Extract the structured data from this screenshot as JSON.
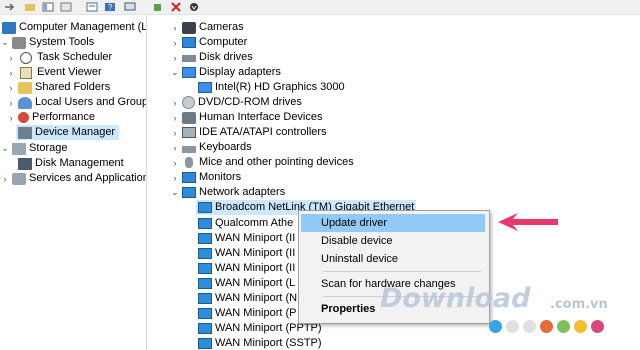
{
  "toolbar": {
    "icons": [
      "forward-arrow-icon",
      "up-folder-icon",
      "show-hide-tree-icon",
      "properties-icon",
      "help-icon",
      "view-icon",
      "monitor-icon",
      "update-driver-icon",
      "uninstall-icon",
      "scan-icon"
    ]
  },
  "left_tree": {
    "root": "Computer Management (Local",
    "items": [
      {
        "label": "System Tools",
        "icon": "tools-icon"
      },
      {
        "label": "Task Scheduler",
        "icon": "clock-icon"
      },
      {
        "label": "Event Viewer",
        "icon": "log-icon"
      },
      {
        "label": "Shared Folders",
        "icon": "folder-icon"
      },
      {
        "label": "Local Users and Groups",
        "icon": "users-icon"
      },
      {
        "label": "Performance",
        "icon": "performance-icon"
      },
      {
        "label": "Device Manager",
        "icon": "device-manager-icon"
      },
      {
        "label": "Storage",
        "icon": "storage-icon"
      },
      {
        "label": "Disk Management",
        "icon": "disk-icon"
      },
      {
        "label": "Services and Applications",
        "icon": "services-icon"
      }
    ]
  },
  "device_tree": {
    "items": [
      {
        "label": "Cameras"
      },
      {
        "label": "Computer"
      },
      {
        "label": "Disk drives"
      },
      {
        "label": "Display adapters"
      },
      {
        "label": "Intel(R) HD Graphics 3000"
      },
      {
        "label": "DVD/CD-ROM drives"
      },
      {
        "label": "Human Interface Devices"
      },
      {
        "label": "IDE ATA/ATAPI controllers"
      },
      {
        "label": "Keyboards"
      },
      {
        "label": "Mice and other pointing devices"
      },
      {
        "label": "Monitors"
      },
      {
        "label": "Network adapters"
      },
      {
        "label": "Broadcom NetLink (TM) Gigabit Ethernet"
      },
      {
        "label": "Qualcomm Athe"
      },
      {
        "label": "WAN Miniport (II"
      },
      {
        "label": "WAN Miniport (II"
      },
      {
        "label": "WAN Miniport (II"
      },
      {
        "label": "WAN Miniport (L"
      },
      {
        "label": "WAN Miniport (N"
      },
      {
        "label": "WAN Miniport (P"
      },
      {
        "label": "WAN Miniport (PPTP)"
      },
      {
        "label": "WAN Miniport (SSTP)"
      }
    ]
  },
  "context_menu": {
    "items": [
      "Update driver",
      "Disable device",
      "Uninstall device",
      "Scan for hardware changes",
      "Properties"
    ]
  },
  "watermark": {
    "brand": "Download",
    "domain": ".com.vn"
  },
  "colors": {
    "selection": "#cce8ff",
    "menu_highlight": "#91c9f7",
    "arrow": "#e8386b",
    "dots": [
      "#3aa3e3",
      "#e0e0e0",
      "#e0e0e0",
      "#e46b3a",
      "#7cc35a",
      "#f1bf2f",
      "#d94a7a"
    ]
  }
}
